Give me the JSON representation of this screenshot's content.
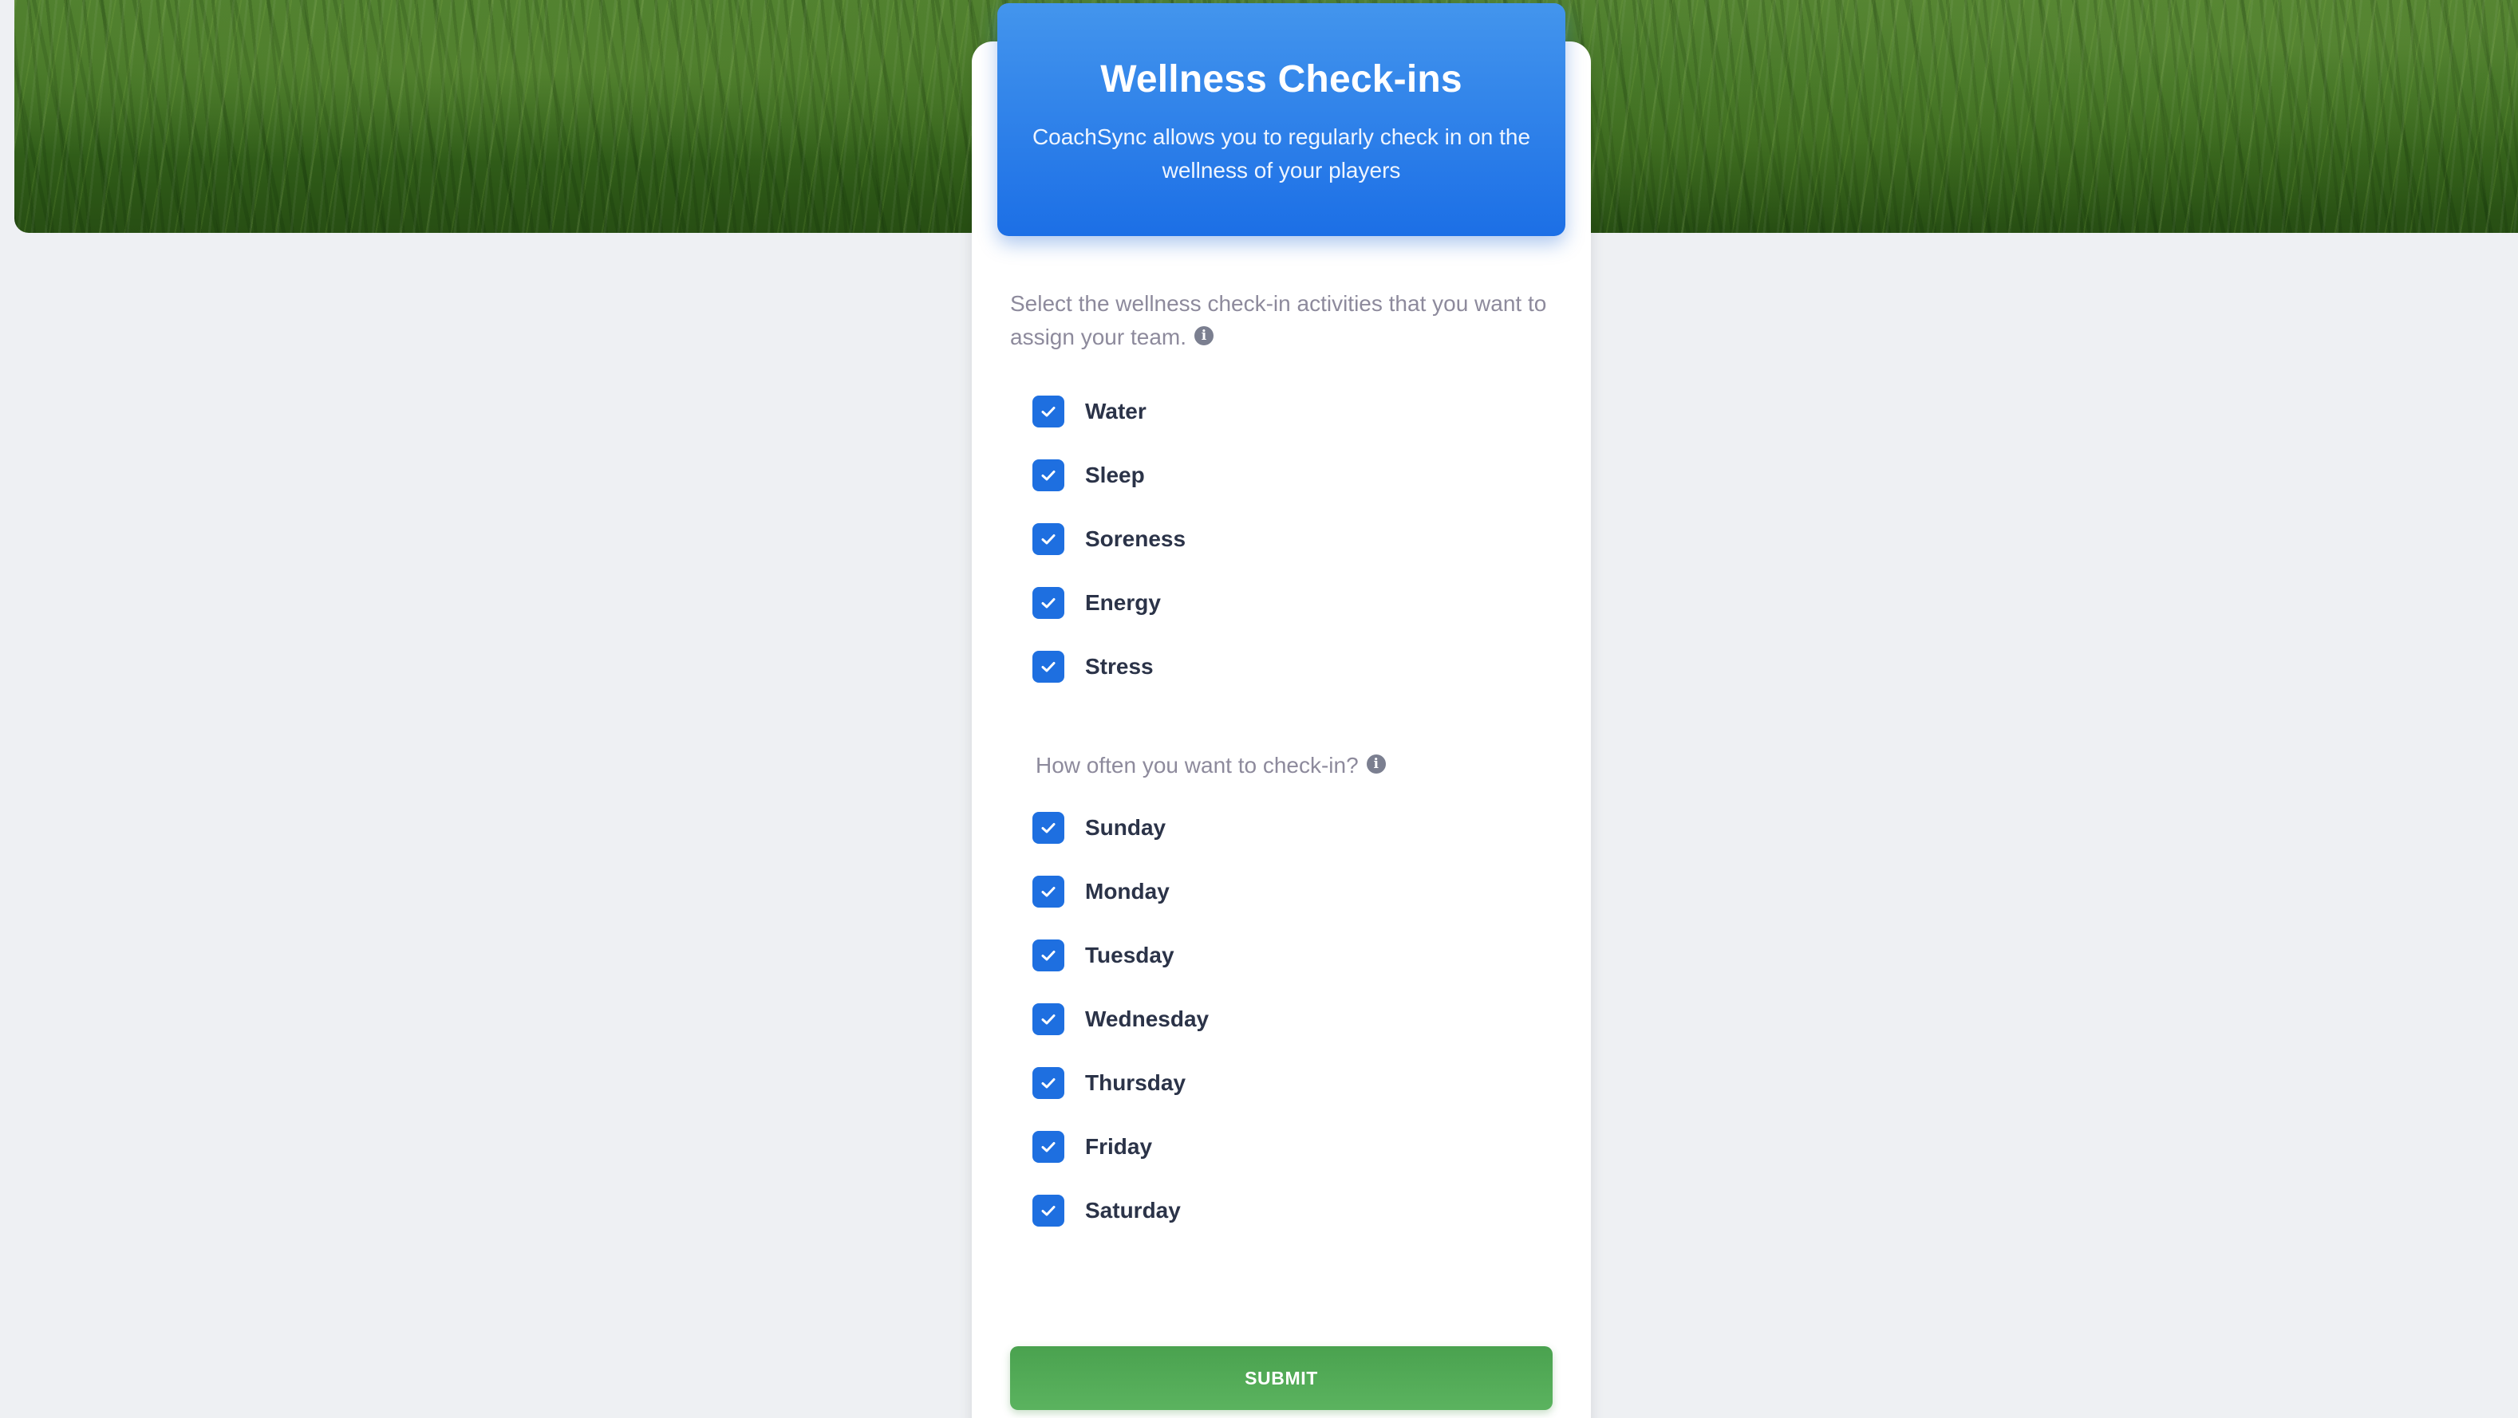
{
  "header": {
    "title": "Wellness Check-ins",
    "subtitle": "CoachSync allows you to regularly check in on the wellness of your players"
  },
  "activities": {
    "prompt": "Select the wellness check-in activities that you want to assign your team.",
    "items": [
      {
        "label": "Water",
        "checked": true
      },
      {
        "label": "Sleep",
        "checked": true
      },
      {
        "label": "Soreness",
        "checked": true
      },
      {
        "label": "Energy",
        "checked": true
      },
      {
        "label": "Stress",
        "checked": true
      }
    ]
  },
  "frequency": {
    "prompt": "How often you want to check-in?",
    "days": [
      {
        "label": "Sunday",
        "checked": true
      },
      {
        "label": "Monday",
        "checked": true
      },
      {
        "label": "Tuesday",
        "checked": true
      },
      {
        "label": "Wednesday",
        "checked": true
      },
      {
        "label": "Thursday",
        "checked": true
      },
      {
        "label": "Friday",
        "checked": true
      },
      {
        "label": "Saturday",
        "checked": true
      }
    ]
  },
  "submit_label": "SUBMIT",
  "colors": {
    "header_blue": "#1c6fe6",
    "checkbox_blue": "#1e6fe0",
    "submit_green": "#4aa24f",
    "page_bg": "#eef0f3"
  },
  "icons": {
    "info": "info-icon",
    "check": "check-icon",
    "banner": "grass-banner"
  }
}
